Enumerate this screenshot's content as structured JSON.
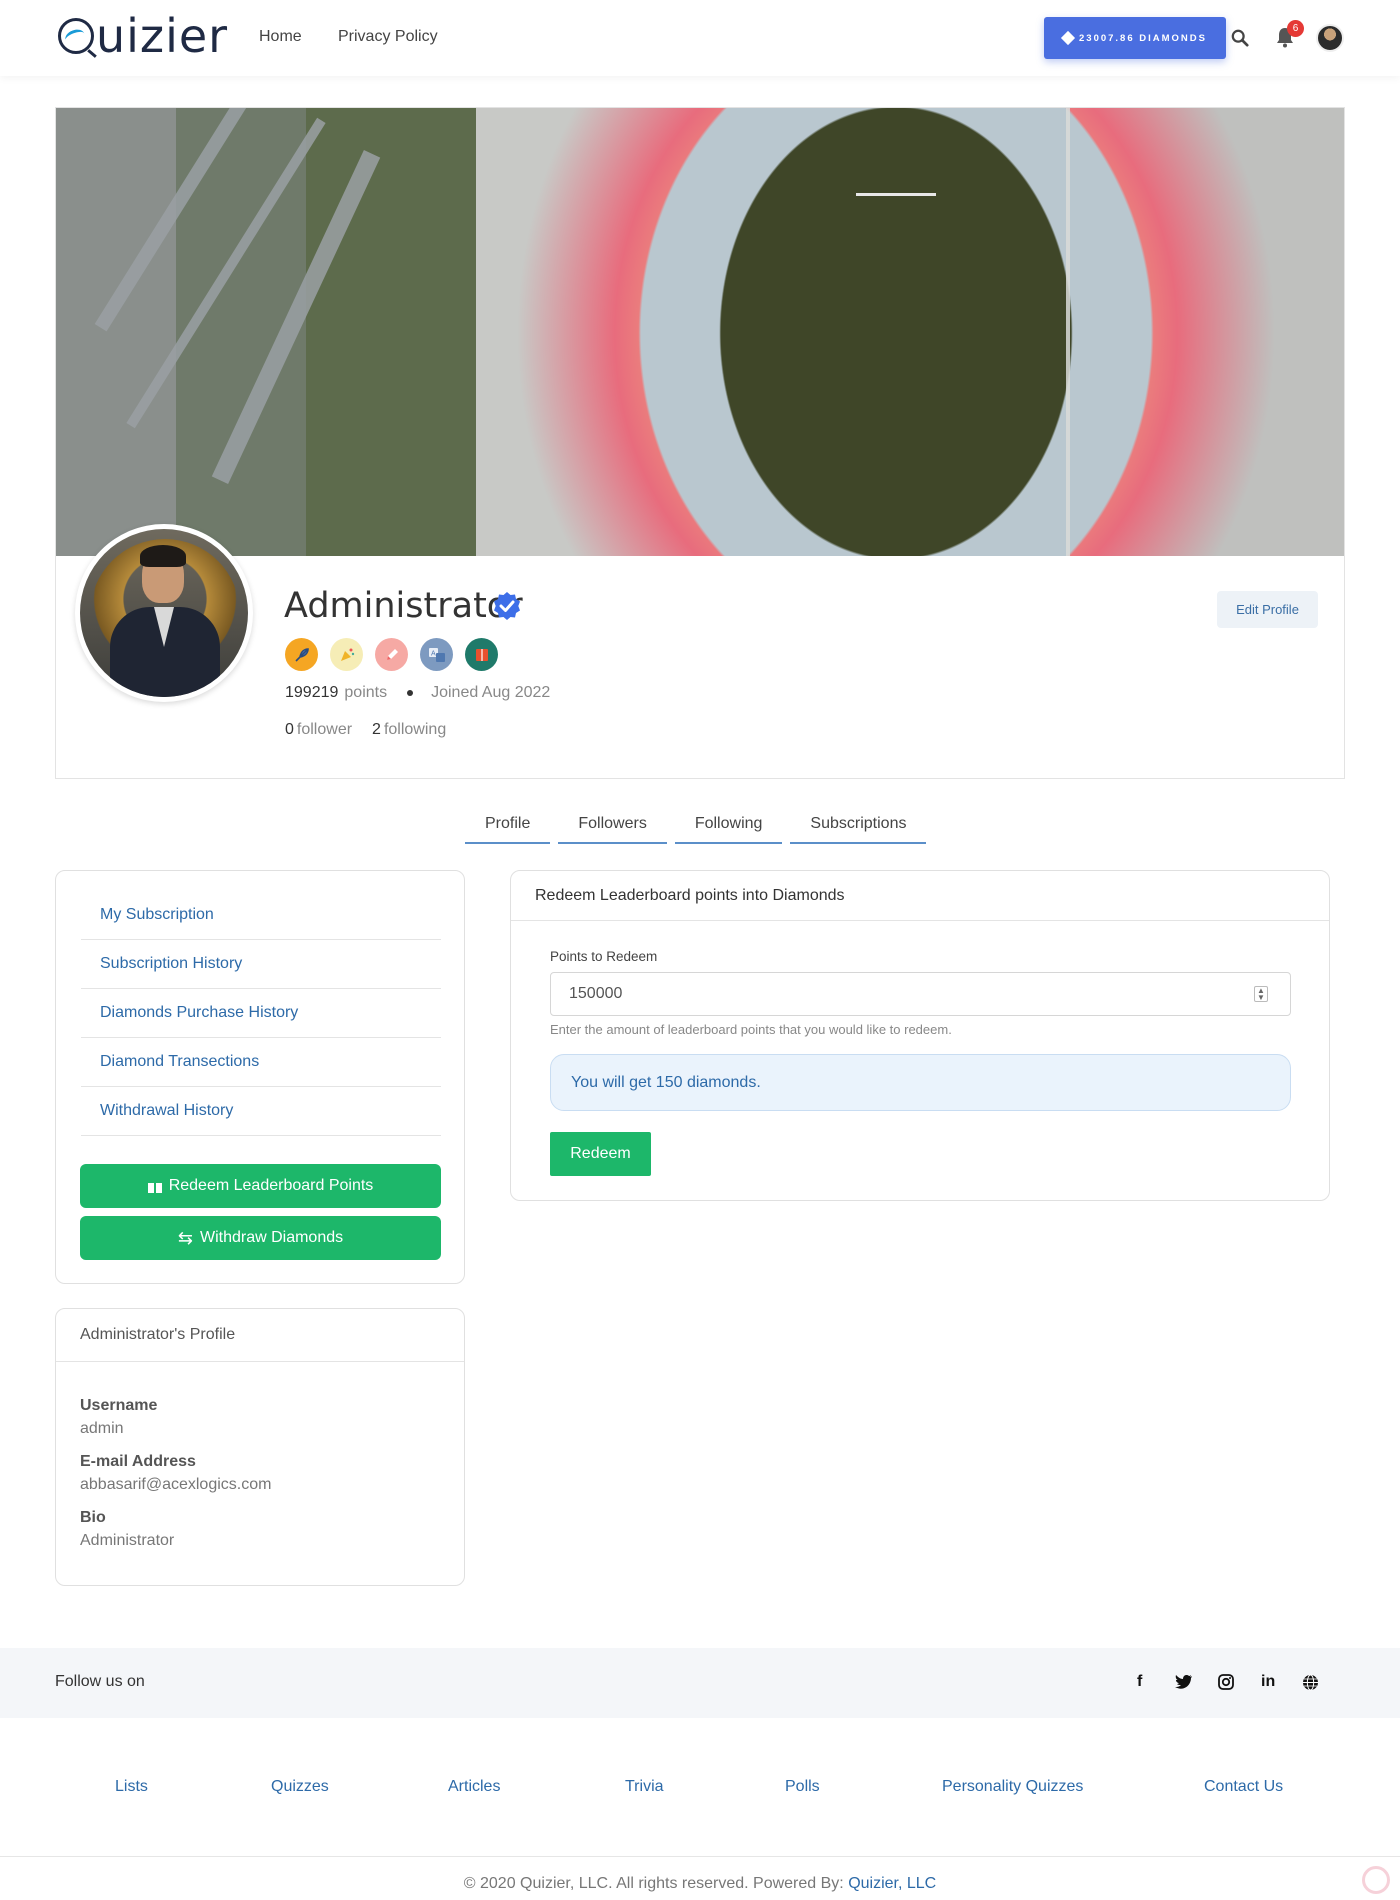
{
  "nav": {
    "logo_text": "uizier",
    "links": [
      "Home",
      "Privacy Policy"
    ],
    "diamonds_label": "23007.86 DIAMONDS",
    "notifications_count": "6"
  },
  "profile": {
    "name": "Administrator",
    "points": "199219",
    "points_label": "points",
    "joined": "Joined Aug 2022",
    "followers_count": "0",
    "followers_label": "follower",
    "following_count": "2",
    "following_label": "following",
    "edit_label": "Edit Profile",
    "badges": [
      {
        "icon": "feather-badge-icon",
        "color": "#f5a623"
      },
      {
        "icon": "party-badge-icon",
        "color": "#f6e7a6"
      },
      {
        "icon": "pencil-badge-icon",
        "color": "#f4a3a3"
      },
      {
        "icon": "translate-badge-icon",
        "color": "#7d9ac0"
      },
      {
        "icon": "book-badge-icon",
        "color": "#1f7a6a"
      }
    ]
  },
  "tabs": [
    "Profile",
    "Followers",
    "Following",
    "Subscriptions"
  ],
  "sidebar": {
    "links": [
      "My Subscription",
      "Subscription History",
      "Diamonds Purchase History",
      "Diamond Transections",
      "Withdrawal History"
    ],
    "redeem_button": "Redeem Leaderboard Points",
    "withdraw_button": "Withdraw Diamonds"
  },
  "about": {
    "title": "Administrator's Profile",
    "username_label": "Username",
    "username": "admin",
    "email_label": "E-mail Address",
    "email": "abbasarif@acexlogics.com",
    "bio_label": "Bio",
    "bio": "Administrator"
  },
  "redeem": {
    "title": "Redeem Leaderboard points into Diamonds",
    "field_label": "Points to Redeem",
    "value": "150000",
    "help": "Enter the amount of leaderboard points that you would like to redeem.",
    "alert": "You will get 150 diamonds.",
    "button": "Redeem"
  },
  "footer": {
    "follow_text": "Follow us on",
    "social": [
      "f",
      "twitter",
      "instagram",
      "in",
      "globe"
    ],
    "links": [
      "Lists",
      "Quizzes",
      "Articles",
      "Trivia",
      "Polls",
      "Personality Quizzes",
      "Contact Us"
    ],
    "copyright": "© 2020 Quizier, LLC. All rights reserved. Powered By:",
    "powered_link": "Quizier, LLC"
  },
  "colors": {
    "primary_blue": "#4a6ee0",
    "success_green": "#1db76a",
    "link_blue": "#2d6aa8",
    "alert_bg": "#eaf3fc"
  }
}
